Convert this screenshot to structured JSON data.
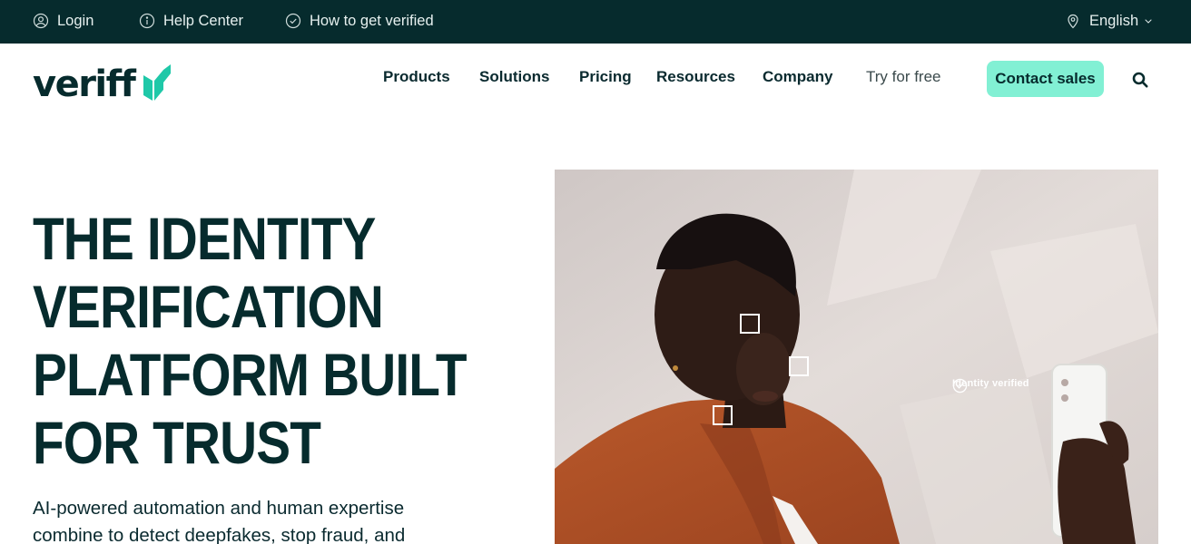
{
  "topbar": {
    "login": "Login",
    "help": "Help Center",
    "verify": "How to get verified",
    "language": "English"
  },
  "nav": {
    "logo": "veriff",
    "links": [
      "Products",
      "Solutions",
      "Pricing",
      "Resources",
      "Company"
    ],
    "try_free": "Try for free",
    "contact": "Contact sales"
  },
  "hero": {
    "title_lines": [
      "THE IDENTITY",
      "VERIFICATION",
      "PLATFORM BUILT",
      "FOR TRUST"
    ],
    "subtitle": "AI-powered automation and human expertise combine to detect deepfakes, stop fraud, and",
    "image_badge": "Identity verified"
  },
  "colors": {
    "topbar_bg": "#062b2d",
    "brand_dark": "#062b2d",
    "accent": "#82f0d4",
    "logo_mark": "#1fc8a8"
  }
}
